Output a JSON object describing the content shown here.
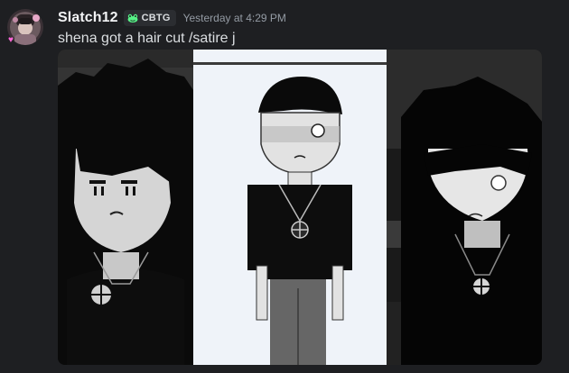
{
  "message": {
    "author": {
      "username": "Slatch12",
      "tag": "CBTG",
      "tag_icon": "frog-icon",
      "avatar_decoration": "heart-icon"
    },
    "timestamp": "Yesterday at 4:29 PM",
    "content": "shena got a hair cut /satire j",
    "attachment": {
      "type": "image",
      "panels": [
        "left-character-panel",
        "center-character-panel",
        "right-character-panel"
      ]
    }
  },
  "colors": {
    "background": "#1e1f22",
    "username": "#f2f3f5",
    "text": "#dbdee1",
    "timestamp": "#949ba4",
    "tag_background": "#2b2d31",
    "tag_icon": "#57f287"
  }
}
